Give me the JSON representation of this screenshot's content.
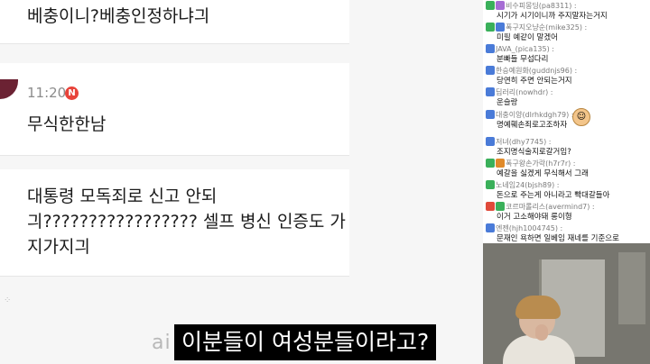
{
  "feed": {
    "comments": [
      {
        "text": "베충이니?베충인정하냐긔"
      },
      {
        "time": "11:20",
        "badge": "N",
        "text": "무식한한남"
      },
      {
        "text_line1": "대통령 모독죄로 신고 안되",
        "text_line2": "긔????????????????? 셀프 병신 인증도 가",
        "text_line3": "지가지긔"
      }
    ],
    "subtitle": "이분들이 여성분들이라고?",
    "watermark": "ai"
  },
  "chat": {
    "messages": [
      {
        "user": "비수피몽딩(pa8311) :",
        "text": "시기가 시기이니까 주지말자는거지",
        "badge_color": "#3ab05a"
      },
      {
        "user": "폭구지오냥순(mike325) :",
        "text": "미필 예같이 말겠어",
        "badge_color": "#3ab05a"
      },
      {
        "user": "JAVA_(pica135) :",
        "text": "분빠들 무섭다리",
        "badge_color": "#4a7bd8"
      },
      {
        "user": "한승예원화(guddnjs96) :",
        "text": "당연히 주면 안되는거지",
        "badge_color": "#4a7bd8"
      },
      {
        "user": "딥러리(nowhdr) :",
        "text": "운슬랑",
        "badge_color": "#4a7bd8"
      },
      {
        "user": "대충이양(dlrhkdgh79) :",
        "text": "명예훼손죄로고조하자",
        "badge_color": "#4a7bd8"
      },
      {
        "user": "저녀(dhy7745) :",
        "text": "조지명식술지로갈거임?",
        "badge_color": "#4a7bd8"
      },
      {
        "user": "폭구왕손가락(h7r7r) :",
        "text": "예갈을 싫겠게 무식해서 그래",
        "badge_color": "#3ab05a"
      },
      {
        "user": "노네임24(bjsh89) :",
        "text": "돈으로 주는게 아니라고 빡대갈들아",
        "badge_color": "#3ab05a"
      },
      {
        "user": "코르마롤리스(avermind7) :",
        "text": "이거 고소해야돼 롱이형",
        "badge_color": "#e04a3a"
      },
      {
        "user": "엔젠(hjh1004745) :",
        "text": "문재인 욕하면 일베임 재네를 기준으로",
        "badge_color": "#4a7bd8"
      }
    ]
  },
  "icons": {
    "new_badge": "new-badge-icon",
    "emote": "emote-icon"
  }
}
